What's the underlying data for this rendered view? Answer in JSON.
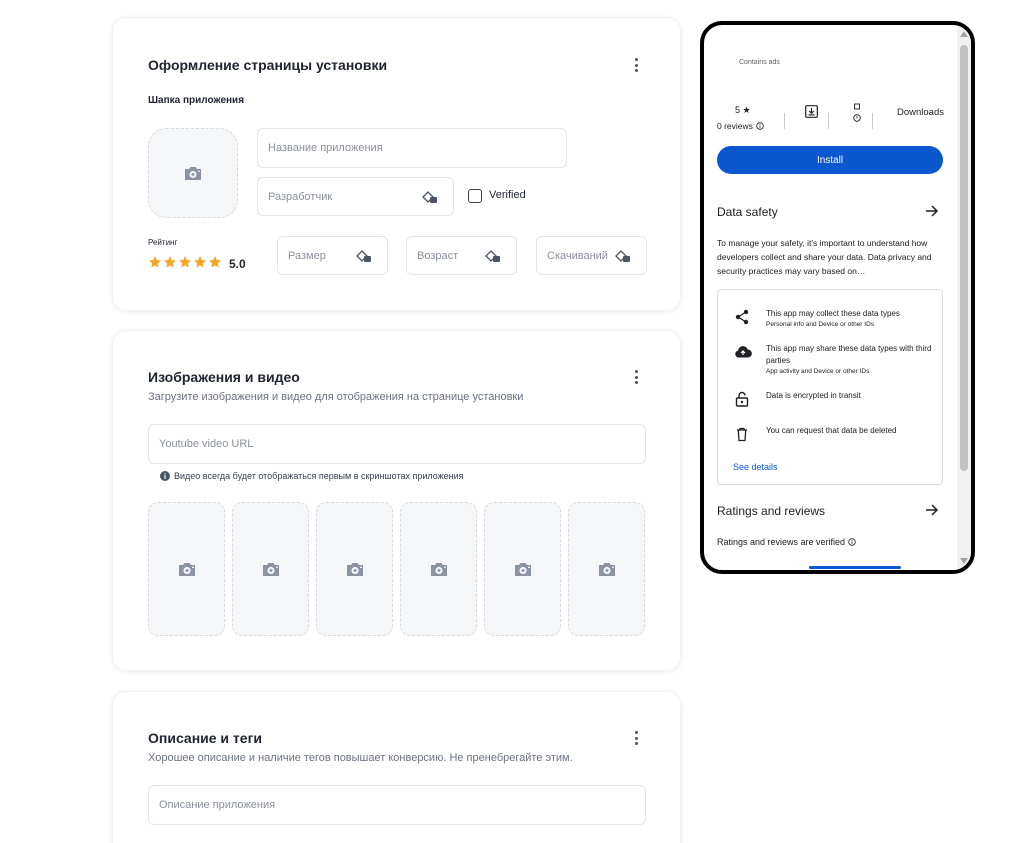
{
  "install_page": {
    "title": "Оформление страницы установки",
    "header_label": "Шапка приложения",
    "app_name_placeholder": "Название приложения",
    "developer_placeholder": "Разработчик",
    "verified_label": "Verified",
    "rating_label": "Рейтинг",
    "rating_value": "5.0",
    "rating_stars": 5,
    "size_placeholder": "Размер",
    "age_placeholder": "Возраст",
    "downloads_placeholder": "Скачиваний"
  },
  "media": {
    "title": "Изображения и видео",
    "subtitle": "Загрузите изображения и видео для отображения на странице установки",
    "youtube_placeholder": "Youtube video URL",
    "hint": "Видео всегда будет отображаться первым в скриншотах приложения",
    "screenshot_slots": 6
  },
  "description": {
    "title": "Описание и теги",
    "subtitle": "Хорошее описание и наличие тегов повышает конверсию. Не пренебрегайте этим.",
    "description_placeholder": "Описание приложения"
  },
  "preview": {
    "contains_ads": "Contains ads",
    "rating": "5 ★",
    "reviews": "0 reviews",
    "downloads_label": "Downloads",
    "install_label": "Install",
    "data_safety_title": "Data safety",
    "data_safety_text": "To manage your safety, it's important to understand how developers collect and share your data. Data privacy and security practices may vary based on…",
    "safety_items": [
      {
        "icon": "share-icon",
        "title": "This app may collect these data types",
        "sub": "Personal info and Device or other IDs"
      },
      {
        "icon": "cloud-upload-icon",
        "title": "This app may share these data types with third parties",
        "sub": "App activity and Device or other IDs"
      },
      {
        "icon": "lock-icon",
        "title": "Data is encrypted in transit",
        "sub": ""
      },
      {
        "icon": "trash-icon",
        "title": "You can request that data be deleted",
        "sub": ""
      }
    ],
    "see_details": "See details",
    "ratings_title": "Ratings and reviews",
    "ratings_verified": "Ratings and reviews are verified"
  },
  "colors": {
    "accent": "#0b57d0",
    "star": "#f5a623",
    "link": "#0b57d0"
  }
}
